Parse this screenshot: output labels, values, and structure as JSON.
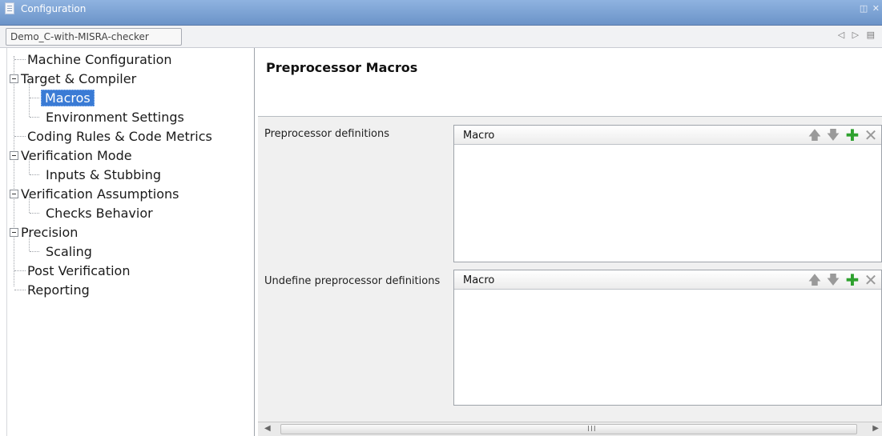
{
  "window": {
    "title": "Configuration",
    "controls": "◫ ✕"
  },
  "tabbar": {
    "context_label": "Demo_C-with-MISRA-checker",
    "nav_icons": "◁ ▷ ▤"
  },
  "tree": {
    "items": [
      {
        "label": "Machine Configuration"
      },
      {
        "label": "Target & Compiler"
      },
      {
        "label": "Macros"
      },
      {
        "label": "Environment Settings"
      },
      {
        "label": "Coding Rules & Code Metrics"
      },
      {
        "label": "Verification Mode"
      },
      {
        "label": "Inputs & Stubbing"
      },
      {
        "label": "Verification Assumptions"
      },
      {
        "label": "Checks Behavior"
      },
      {
        "label": "Precision"
      },
      {
        "label": "Scaling"
      },
      {
        "label": "Post Verification"
      },
      {
        "label": "Reporting"
      }
    ],
    "selected": "Macros"
  },
  "panel": {
    "title": "Preprocessor Macros",
    "sections": [
      {
        "label": "Preprocessor definitions",
        "column": "Macro"
      },
      {
        "label": "Undefine preprocessor definitions",
        "column": "Macro"
      }
    ]
  },
  "icons": {
    "move_up": "arrow-up-icon",
    "move_down": "arrow-down-icon",
    "add": "plus-icon",
    "remove": "close-icon"
  },
  "scrollbar": {
    "grip": "III"
  }
}
